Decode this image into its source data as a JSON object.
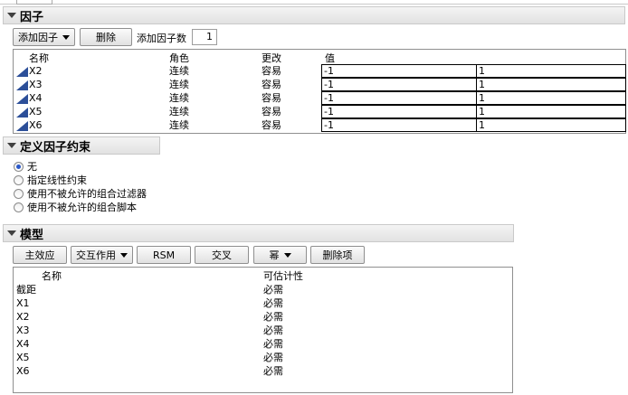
{
  "factors": {
    "title": "因子",
    "add_factor_menu": "添加因子",
    "delete_button": "删除",
    "add_count_label": "添加因子数",
    "add_count_value": "1",
    "columns": {
      "name": "名称",
      "role": "角色",
      "changes": "更改",
      "values": "值"
    },
    "rows": [
      {
        "name": "X2",
        "role": "连续",
        "changes": "容易",
        "low": "-1",
        "high": "1"
      },
      {
        "name": "X3",
        "role": "连续",
        "changes": "容易",
        "low": "-1",
        "high": "1"
      },
      {
        "name": "X4",
        "role": "连续",
        "changes": "容易",
        "low": "-1",
        "high": "1"
      },
      {
        "name": "X5",
        "role": "连续",
        "changes": "容易",
        "low": "-1",
        "high": "1"
      },
      {
        "name": "X6",
        "role": "连续",
        "changes": "容易",
        "low": "-1",
        "high": "1"
      }
    ],
    "factor_icon": "continuous-factor-icon"
  },
  "constraints": {
    "title": "定义因子约束",
    "selected": 0,
    "options": [
      "无",
      "指定线性约束",
      "使用不被允许的组合过滤器",
      "使用不被允许的组合脚本"
    ]
  },
  "model": {
    "title": "模型",
    "buttons": {
      "main_effects": "主效应",
      "interactions": "交互作用",
      "rsm": "RSM",
      "cross": "交叉",
      "powers": "幂",
      "remove_term": "删除项"
    },
    "columns": {
      "name": "名称",
      "estimability": "可估计性"
    },
    "rows": [
      {
        "name": "截距",
        "estimability": "必需"
      },
      {
        "name": "X1",
        "estimability": "必需"
      },
      {
        "name": "X2",
        "estimability": "必需"
      },
      {
        "name": "X3",
        "estimability": "必需"
      },
      {
        "name": "X4",
        "estimability": "必需"
      },
      {
        "name": "X5",
        "estimability": "必需"
      },
      {
        "name": "X6",
        "estimability": "必需"
      }
    ]
  },
  "colors": {
    "accent": "#2c4f99",
    "header_bg": "#e8e8e8"
  }
}
